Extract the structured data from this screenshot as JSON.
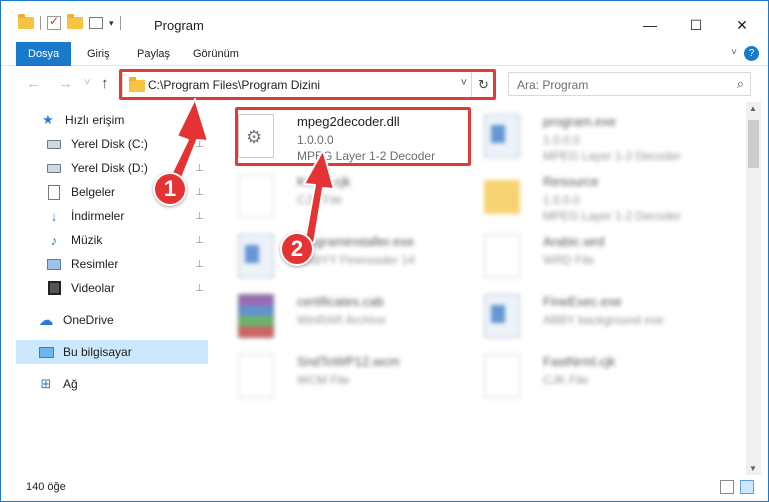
{
  "window": {
    "title": "Program",
    "minimize_glyph": "—",
    "maximize_glyph": "☐",
    "close_glyph": "✕"
  },
  "ribbon": {
    "tabs": [
      "Dosya",
      "Giriş",
      "Paylaş",
      "Görünüm"
    ],
    "active_tab": "Dosya",
    "help_glyph": "?",
    "accent_color": "#1979ca"
  },
  "address": {
    "path": "C:\\Program Files\\Program Dizini",
    "back_glyph": "←",
    "forward_glyph": "→",
    "recent_glyph": "˅",
    "up_glyph": "↑",
    "dropdown_glyph": "˅",
    "refresh_glyph": "↻"
  },
  "search": {
    "placeholder": "Ara: Program",
    "icon": "⌕"
  },
  "sidebar": {
    "items": [
      {
        "label": "Hızlı erişim",
        "icon": "star-icon",
        "pinned": false
      },
      {
        "label": "Yerel Disk (C:)",
        "icon": "disk-icon",
        "pinned": true
      },
      {
        "label": "Yerel Disk (D:)",
        "icon": "disk-icon",
        "pinned": true
      },
      {
        "label": "Belgeler",
        "icon": "documents-icon",
        "pinned": true
      },
      {
        "label": "İndirmeler",
        "icon": "download-icon",
        "pinned": true
      },
      {
        "label": "Müzik",
        "icon": "music-icon",
        "pinned": true
      },
      {
        "label": "Resimler",
        "icon": "pictures-icon",
        "pinned": true
      },
      {
        "label": "Videolar",
        "icon": "videos-icon",
        "pinned": true
      },
      {
        "label": "OneDrive",
        "icon": "cloud-icon",
        "pinned": false
      },
      {
        "label": "Bu bilgisayar",
        "icon": "computer-icon",
        "pinned": false,
        "selected": true
      },
      {
        "label": "Ağ",
        "icon": "network-icon",
        "pinned": false
      }
    ],
    "pin_glyph": "📌"
  },
  "files": [
    {
      "name": "mpeg2decoder.dll",
      "line1": "1.0.0.0",
      "line2": "MPEG Layer 1-2 Decoder",
      "icon": "dll-gear-icon",
      "highlighted": true
    },
    {
      "name": "program.exe",
      "line1": "1.0.0.0",
      "line2": "MPEG Layer 1-2 Decoder",
      "icon": "app-icon",
      "blurred": true
    },
    {
      "name": "Kondt.cjk",
      "line1": "CJK File",
      "line2": "",
      "icon": "blank-file-icon",
      "blurred": true
    },
    {
      "name": "Resource",
      "line1": "1.0.0.0",
      "line2": "MPEG Layer 1-2 Decoder",
      "icon": "folder-icon",
      "blurred": true
    },
    {
      "name": "programinstaller.exe",
      "line1": "ABBYY Finereader 14",
      "line2": "",
      "icon": "app-icon",
      "blurred": true
    },
    {
      "name": "Arabic.wrd",
      "line1": "WRD File",
      "line2": "",
      "icon": "blank-file-icon",
      "blurred": true
    },
    {
      "name": "certificates.cab",
      "line1": "WinRAR Archive",
      "line2": "",
      "icon": "winrar-icon",
      "blurred": true
    },
    {
      "name": "FineExec.exe",
      "line1": "ABBY background exe",
      "line2": "",
      "icon": "app-icon",
      "blurred": true
    },
    {
      "name": "SndToWP12.wcm",
      "line1": "WCM File",
      "line2": "",
      "icon": "blank-file-icon",
      "blurred": true
    },
    {
      "name": "FastNrml.cjk",
      "line1": "CJK File",
      "line2": "",
      "icon": "blank-file-icon",
      "blurred": true
    }
  ],
  "annotations": {
    "step1": "1",
    "step2": "2",
    "color": "#e53232"
  },
  "status": {
    "item_count": "140 öğe"
  }
}
